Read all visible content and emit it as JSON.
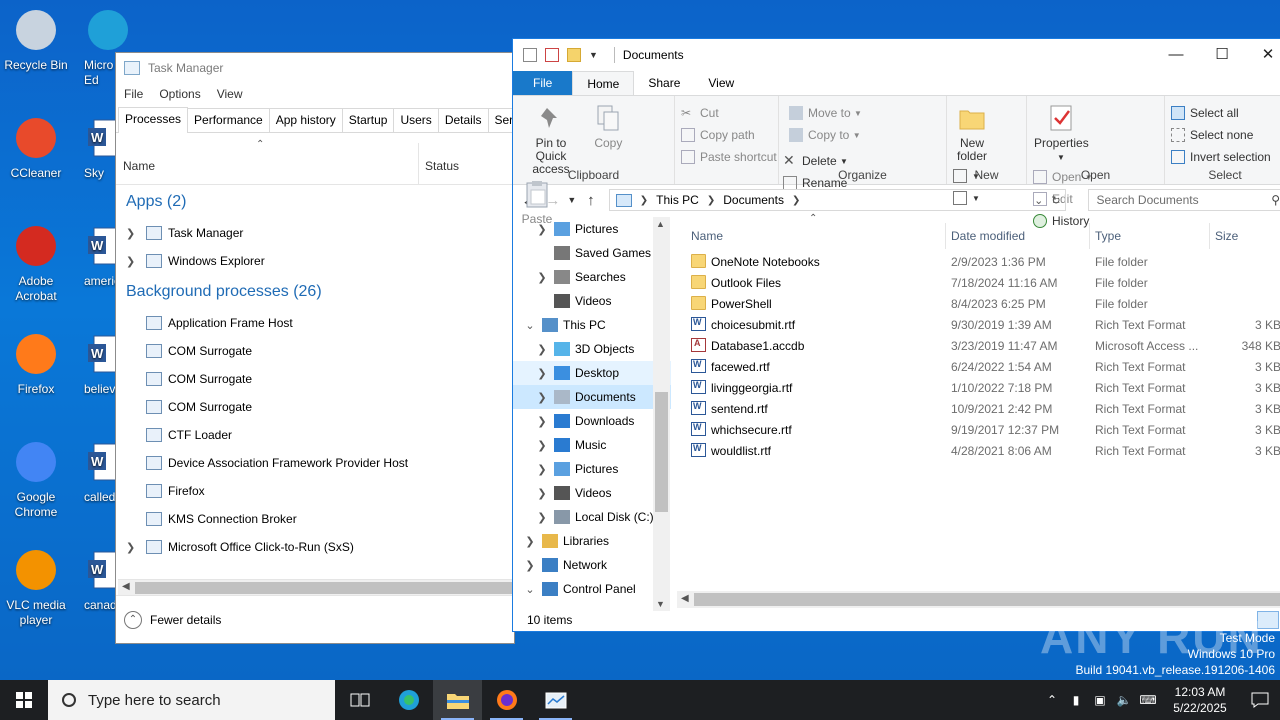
{
  "desktop": {
    "icons_left": [
      {
        "label": "Recycle Bin"
      },
      {
        "label": "CCleaner"
      },
      {
        "label": "Adobe Acrobat"
      },
      {
        "label": "Firefox"
      },
      {
        "label": "Google Chrome"
      },
      {
        "label": "VLC media player"
      }
    ],
    "icons_right": [
      {
        "label": "Micro Ed"
      },
      {
        "label": "Sky"
      },
      {
        "label": "americ"
      },
      {
        "label": "believe"
      },
      {
        "label": "called"
      },
      {
        "label": "canadi"
      }
    ]
  },
  "taskmgr": {
    "title": "Task Manager",
    "menu": [
      "File",
      "Options",
      "View"
    ],
    "tabs": [
      "Processes",
      "Performance",
      "App history",
      "Startup",
      "Users",
      "Details",
      "Service"
    ],
    "col_name": "Name",
    "col_status": "Status",
    "apps_header": "Apps (2)",
    "apps": [
      "Task Manager",
      "Windows Explorer"
    ],
    "bg_header": "Background processes (26)",
    "bg": [
      {
        "name": "Application Frame Host",
        "expand": false
      },
      {
        "name": "COM Surrogate",
        "expand": false
      },
      {
        "name": "COM Surrogate",
        "expand": false
      },
      {
        "name": "COM Surrogate",
        "expand": false
      },
      {
        "name": "CTF Loader",
        "expand": false
      },
      {
        "name": "Device Association Framework Provider Host",
        "expand": false
      },
      {
        "name": "Firefox",
        "expand": false
      },
      {
        "name": "KMS Connection Broker",
        "expand": false
      },
      {
        "name": "Microsoft Office Click-to-Run (SxS)",
        "expand": true
      }
    ],
    "fewer_details": "Fewer details"
  },
  "explorer": {
    "title": "Documents",
    "ribbon_tabs": [
      "File",
      "Home",
      "Share",
      "View"
    ],
    "clipboard": {
      "pin": "Pin to Quick access",
      "copy": "Copy",
      "paste": "Paste",
      "cut": "Cut",
      "copy_path": "Copy path",
      "paste_shortcut": "Paste shortcut",
      "group": "Clipboard"
    },
    "organize": {
      "move_to": "Move to",
      "copy_to": "Copy to",
      "delete": "Delete",
      "rename": "Rename",
      "group": "Organize"
    },
    "new": {
      "new_folder": "New folder",
      "group": "New"
    },
    "open": {
      "properties": "Properties",
      "open": "Open",
      "edit": "Edit",
      "history": "History",
      "group": "Open"
    },
    "select": {
      "select_all": "Select all",
      "select_none": "Select none",
      "invert": "Invert selection",
      "group": "Select"
    },
    "address": [
      "This PC",
      "Documents"
    ],
    "search_placeholder": "Search Documents",
    "nav": [
      {
        "label": "Pictures",
        "indent": 1,
        "chev": ">",
        "state": ""
      },
      {
        "label": "Saved Games",
        "indent": 1,
        "chev": "",
        "state": ""
      },
      {
        "label": "Searches",
        "indent": 1,
        "chev": ">",
        "state": ""
      },
      {
        "label": "Videos",
        "indent": 1,
        "chev": "",
        "state": ""
      },
      {
        "label": "This PC",
        "indent": 0,
        "chev": "v",
        "state": ""
      },
      {
        "label": "3D Objects",
        "indent": 1,
        "chev": ">",
        "state": ""
      },
      {
        "label": "Desktop",
        "indent": 1,
        "chev": ">",
        "state": "hover"
      },
      {
        "label": "Documents",
        "indent": 1,
        "chev": ">",
        "state": "sel"
      },
      {
        "label": "Downloads",
        "indent": 1,
        "chev": ">",
        "state": ""
      },
      {
        "label": "Music",
        "indent": 1,
        "chev": ">",
        "state": ""
      },
      {
        "label": "Pictures",
        "indent": 1,
        "chev": ">",
        "state": ""
      },
      {
        "label": "Videos",
        "indent": 1,
        "chev": ">",
        "state": ""
      },
      {
        "label": "Local Disk (C:)",
        "indent": 1,
        "chev": ">",
        "state": ""
      },
      {
        "label": "Libraries",
        "indent": 0,
        "chev": ">",
        "state": ""
      },
      {
        "label": "Network",
        "indent": 0,
        "chev": ">",
        "state": ""
      },
      {
        "label": "Control Panel",
        "indent": 0,
        "chev": "v",
        "state": ""
      }
    ],
    "columns": [
      "Name",
      "Date modified",
      "Type",
      "Size"
    ],
    "files": [
      {
        "name": "OneNote Notebooks",
        "date": "2/9/2023 1:36 PM",
        "type": "File folder",
        "size": "",
        "kind": "folder"
      },
      {
        "name": "Outlook Files",
        "date": "7/18/2024 11:16 AM",
        "type": "File folder",
        "size": "",
        "kind": "folder"
      },
      {
        "name": "PowerShell",
        "date": "8/4/2023 6:25 PM",
        "type": "File folder",
        "size": "",
        "kind": "folder"
      },
      {
        "name": "choicesubmit.rtf",
        "date": "9/30/2019 1:39 AM",
        "type": "Rich Text Format",
        "size": "3 KB",
        "kind": "doc"
      },
      {
        "name": "Database1.accdb",
        "date": "3/23/2019 11:47 AM",
        "type": "Microsoft Access ...",
        "size": "348 KB",
        "kind": "acc"
      },
      {
        "name": "facewed.rtf",
        "date": "6/24/2022 1:54 AM",
        "type": "Rich Text Format",
        "size": "3 KB",
        "kind": "doc"
      },
      {
        "name": "livinggeorgia.rtf",
        "date": "1/10/2022 7:18 PM",
        "type": "Rich Text Format",
        "size": "3 KB",
        "kind": "doc"
      },
      {
        "name": "sentend.rtf",
        "date": "10/9/2021 2:42 PM",
        "type": "Rich Text Format",
        "size": "3 KB",
        "kind": "doc"
      },
      {
        "name": "whichsecure.rtf",
        "date": "9/19/2017 12:37 PM",
        "type": "Rich Text Format",
        "size": "3 KB",
        "kind": "doc"
      },
      {
        "name": "wouldlist.rtf",
        "date": "4/28/2021 8:06 AM",
        "type": "Rich Text Format",
        "size": "3 KB",
        "kind": "doc"
      }
    ],
    "status": "10 items"
  },
  "watermark": "ANY RUN",
  "wininfo": {
    "line1": "Test Mode",
    "line2": "Windows 10 Pro",
    "line3": "Build 19041.vb_release.191206-1406"
  },
  "taskbar": {
    "search_placeholder": "Type here to search",
    "time": "12:03 AM",
    "date": "5/22/2025"
  },
  "colors": {
    "accent": "#1979ca",
    "link_blue": "#1f6bb5",
    "taskbar": "#1d1f22"
  }
}
